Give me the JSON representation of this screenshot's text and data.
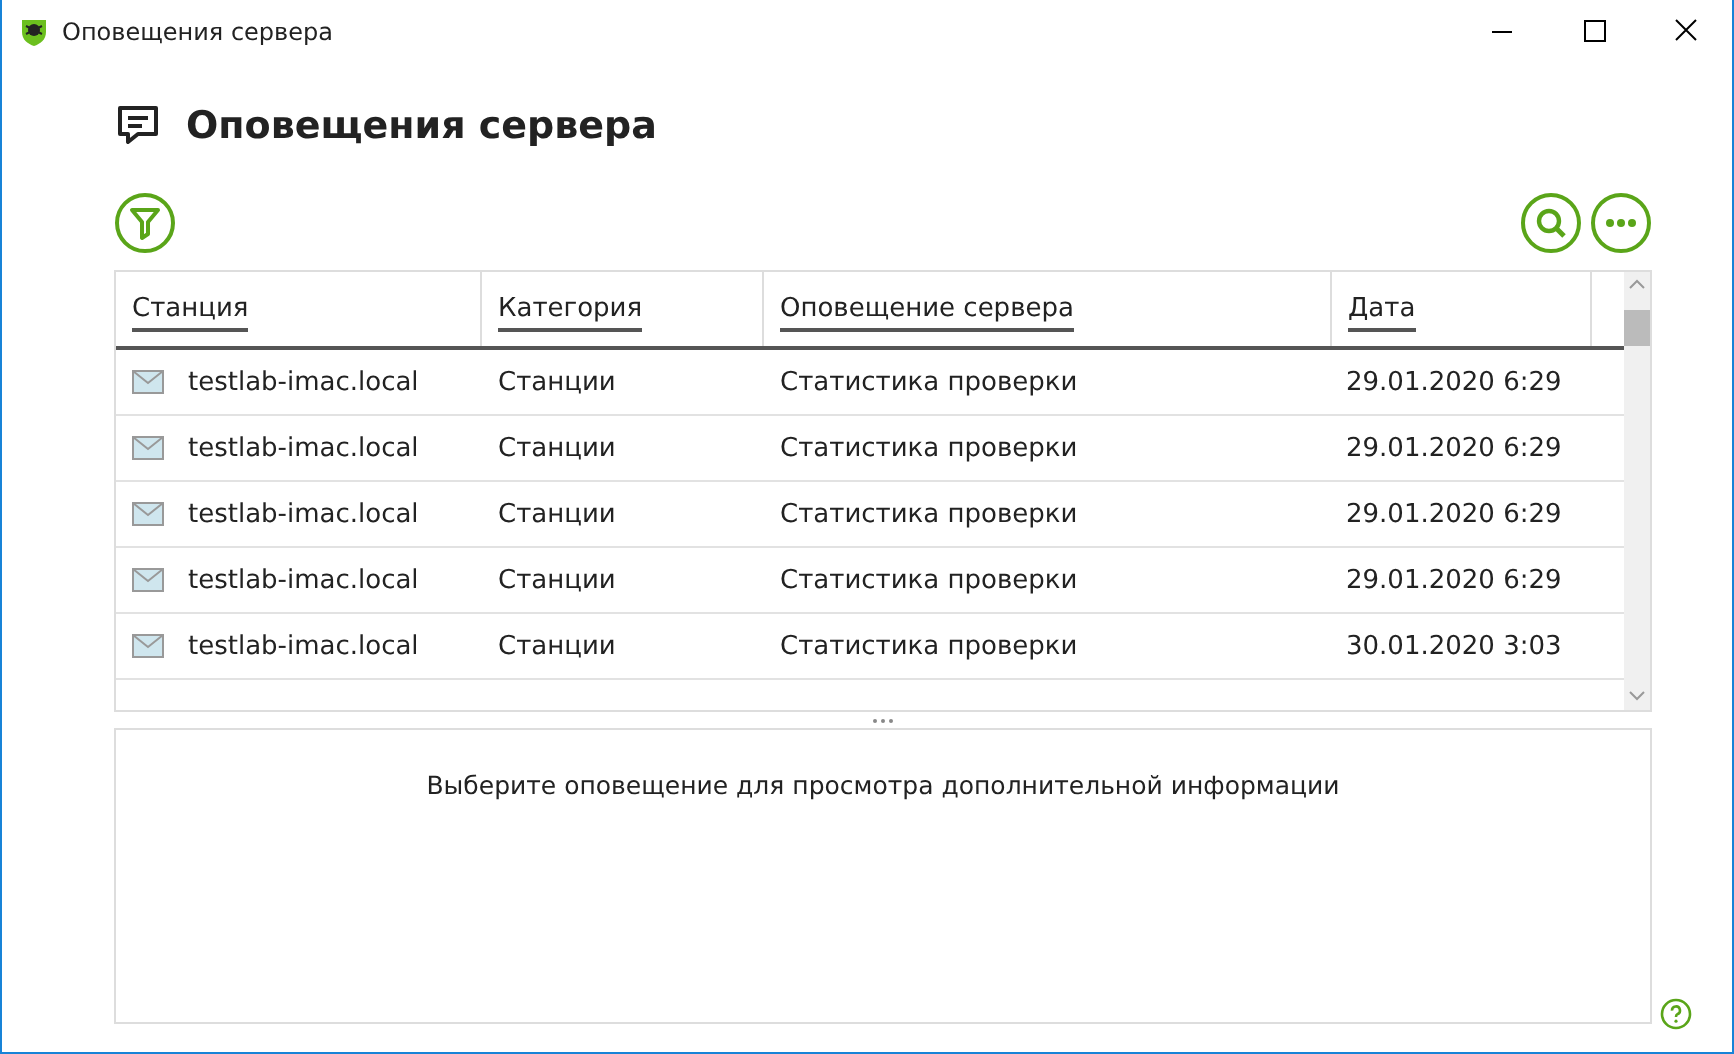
{
  "window": {
    "title": "Оповещения сервера"
  },
  "header": {
    "title": "Оповещения сервера"
  },
  "table": {
    "columns": [
      "Станция",
      "Категория",
      "Оповещение сервера",
      "Дата"
    ],
    "rows": [
      {
        "station": "testlab-imac.local",
        "category": "Станции",
        "alert": "Статистика проверки",
        "date": "29.01.2020 6:29"
      },
      {
        "station": "testlab-imac.local",
        "category": "Станции",
        "alert": "Статистика проверки",
        "date": "29.01.2020 6:29"
      },
      {
        "station": "testlab-imac.local",
        "category": "Станции",
        "alert": "Статистика проверки",
        "date": "29.01.2020 6:29"
      },
      {
        "station": "testlab-imac.local",
        "category": "Станции",
        "alert": "Статистика проверки",
        "date": "29.01.2020 6:29"
      },
      {
        "station": "testlab-imac.local",
        "category": "Станции",
        "alert": "Статистика проверки",
        "date": "30.01.2020 3:03"
      }
    ]
  },
  "details": {
    "message": "Выберите оповещение для просмотра дополнительной информации"
  }
}
